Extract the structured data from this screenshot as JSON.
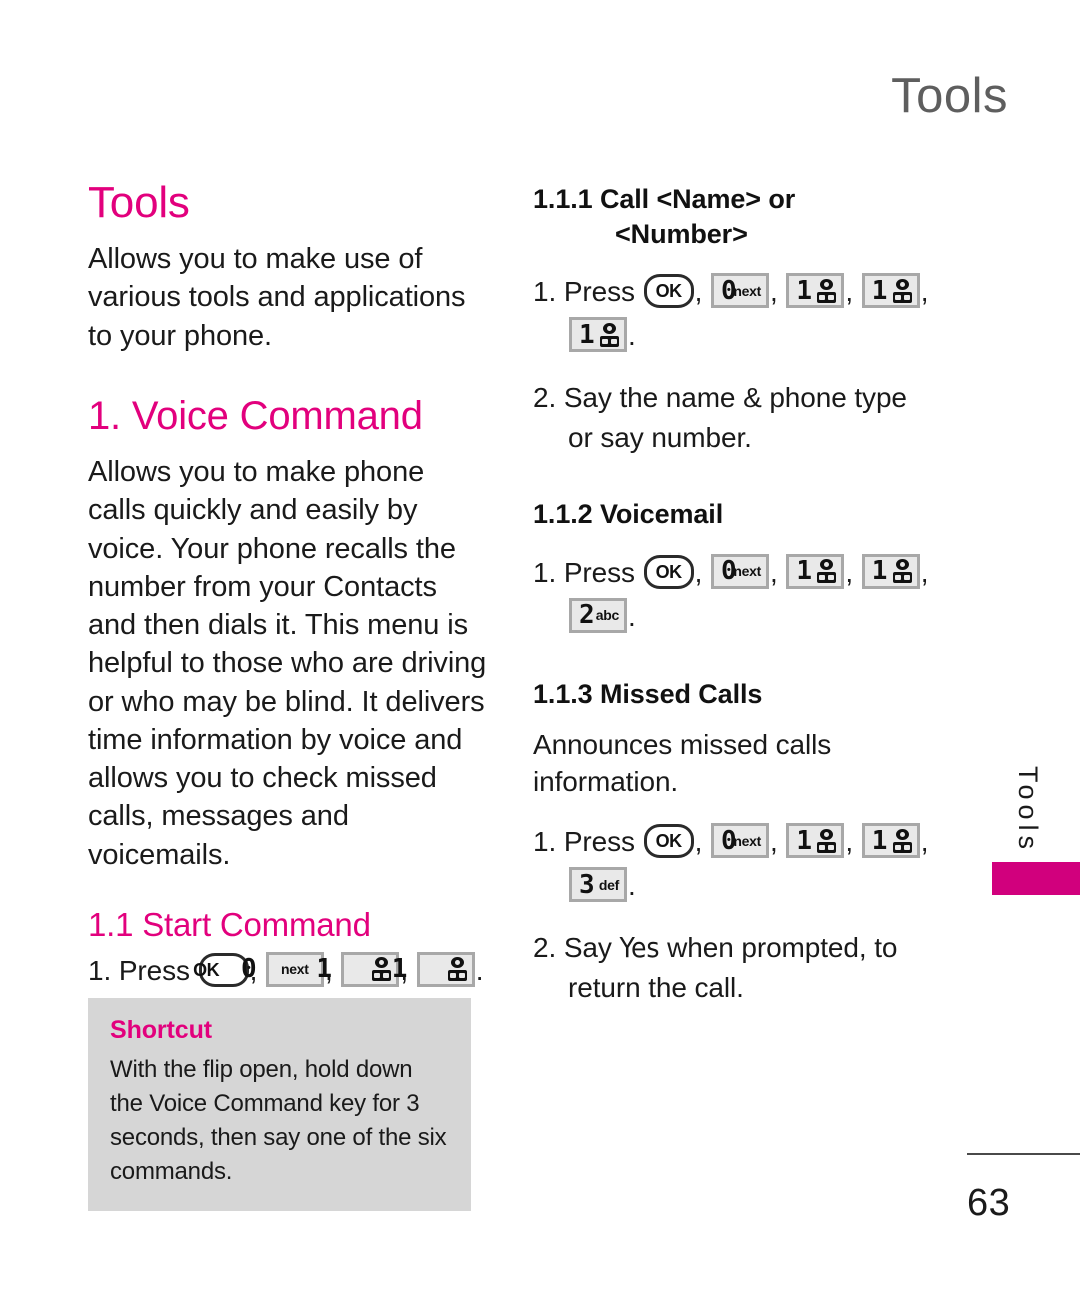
{
  "running_header": "Tools",
  "page_number": "63",
  "side_tab_label": "Tools",
  "colors": {
    "accent_pink": "#e2007d",
    "tab_bar_pink": "#d1007d",
    "header_gray": "#5e5e5e",
    "shortcut_bg": "#d6d6d6",
    "key_face": "#e9e9e9",
    "key_border": "#a8a8a8"
  },
  "left_column": {
    "chapter_title": "Tools",
    "chapter_intro": "Allows you to make use of various tools and applications to your phone.",
    "section_title": "1. Voice Command",
    "section_body": "Allows you to make phone calls quickly and easily by voice. Your phone recalls the number from your Contacts and then dials it. This menu is helpful to those who are driving or who may be blind. It delivers time information by voice and allows you to check missed calls, messages and voicemails.",
    "subsection_title": "1.1 Start Command",
    "step1_prefix": "1. Press",
    "step1_keys": [
      {
        "type": "ok",
        "label": "OK"
      },
      {
        "type": "num",
        "digit": "0",
        "sub": "next"
      },
      {
        "type": "num",
        "digit": "1",
        "sub": "voicemail-icon"
      },
      {
        "type": "num",
        "digit": "1",
        "sub": "voicemail-icon"
      }
    ],
    "step1_terminator": "."
  },
  "shortcut": {
    "title": "Shortcut",
    "body": "With the flip open, hold down the Voice Command key for 3 seconds, then say one of the six commands."
  },
  "right_column": {
    "sub1": {
      "number": "1.1.1",
      "title_line1": "Call <Name> or",
      "title_line2": "<Number>",
      "step1_prefix": "1. Press",
      "step1_keys": [
        {
          "type": "ok",
          "label": "OK"
        },
        {
          "type": "num",
          "digit": "0",
          "sub": "next"
        },
        {
          "type": "num",
          "digit": "1",
          "sub": "voicemail-icon"
        },
        {
          "type": "num",
          "digit": "1",
          "sub": "voicemail-icon"
        },
        {
          "type": "num",
          "digit": "1",
          "sub": "voicemail-icon"
        }
      ],
      "step1_terminator": ".",
      "step2": "2. Say the name & phone type or say number.",
      "step2_line1": "2. Say the name & phone type",
      "step2_line2": "or say number."
    },
    "sub2": {
      "number": "1.1.2",
      "title": "1.1.2 Voicemail",
      "step1_prefix": "1. Press",
      "step1_keys": [
        {
          "type": "ok",
          "label": "OK"
        },
        {
          "type": "num",
          "digit": "0",
          "sub": "next"
        },
        {
          "type": "num",
          "digit": "1",
          "sub": "voicemail-icon"
        },
        {
          "type": "num",
          "digit": "1",
          "sub": "voicemail-icon"
        },
        {
          "type": "num",
          "digit": "2",
          "sub": "abc"
        }
      ],
      "step1_terminator": "."
    },
    "sub3": {
      "number": "1.1.3",
      "title": "1.1.3 Missed Calls",
      "description": "Announces missed calls information.",
      "step1_prefix": "1. Press",
      "step1_keys": [
        {
          "type": "ok",
          "label": "OK"
        },
        {
          "type": "num",
          "digit": "0",
          "sub": "next"
        },
        {
          "type": "num",
          "digit": "1",
          "sub": "voicemail-icon"
        },
        {
          "type": "num",
          "digit": "1",
          "sub": "voicemail-icon"
        },
        {
          "type": "num",
          "digit": "3",
          "sub": "def"
        }
      ],
      "step1_terminator": ".",
      "step2_before": "2. Say",
      "step2_emphasis": "Yes",
      "step2_after": "when prompted, to",
      "step2_line2": "return the call."
    }
  }
}
